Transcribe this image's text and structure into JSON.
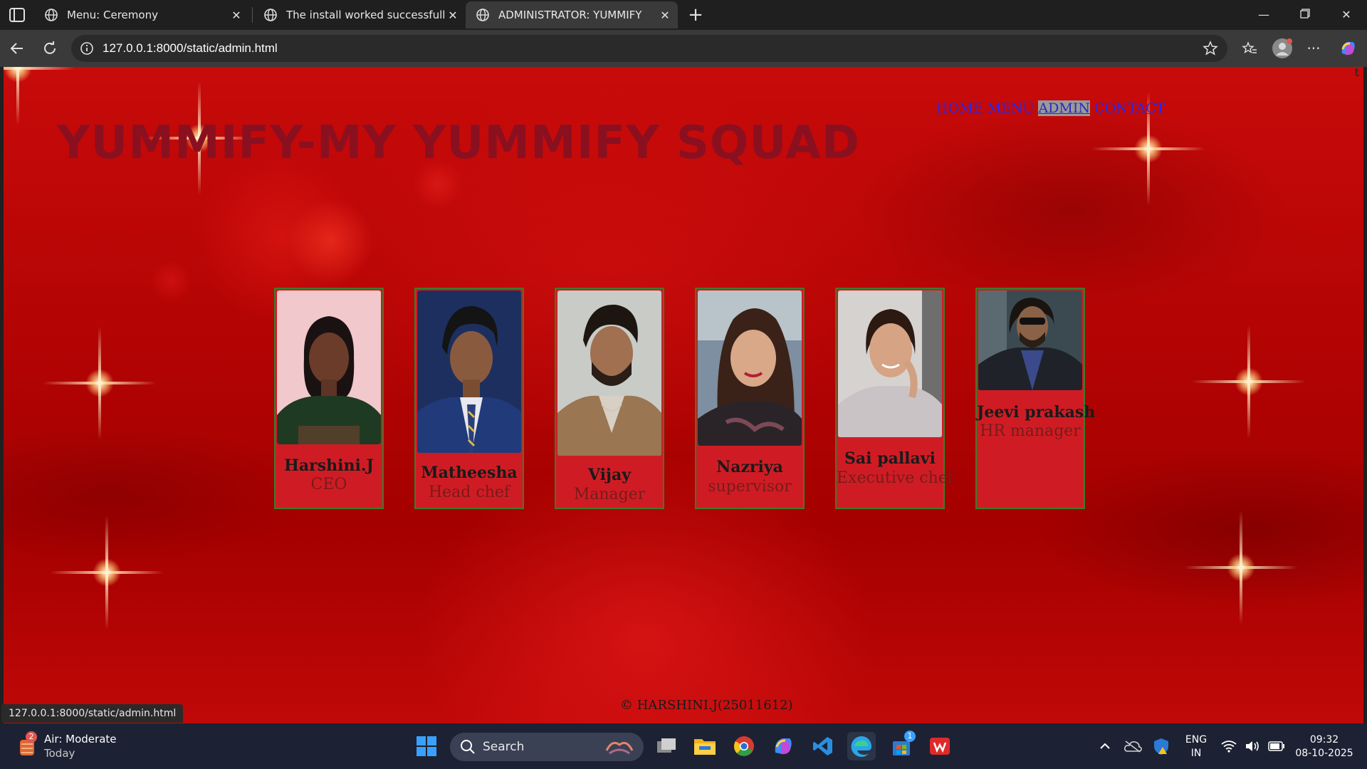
{
  "browser": {
    "tabs": [
      {
        "title": "Menu: Ceremony",
        "active": false
      },
      {
        "title": "The install worked successfully! C",
        "active": false
      },
      {
        "title": "ADMINISTRATOR: YUMMIFY",
        "active": true
      }
    ],
    "url": "127.0.0.1:8000/static/admin.html",
    "status_url": "127.0.0.1:8000/static/admin.html"
  },
  "page": {
    "title": "YUMMIFY-MY YUMMIFY SQUAD",
    "nav": [
      "HOME",
      "MENU",
      "ADMIN",
      "CONTACT"
    ],
    "corner_char": "t",
    "team": [
      {
        "name": "Harshini.J",
        "role": "CEO"
      },
      {
        "name": "Matheesha",
        "role": "Head chef"
      },
      {
        "name": "Vijay",
        "role": "Manager"
      },
      {
        "name": "Nazriya",
        "role": "supervisor"
      },
      {
        "name": "Sai pallavi",
        "role": "Executive chef"
      },
      {
        "name": "Jeevi prakash",
        "role": "HR manager"
      }
    ],
    "footer": "© HARSHINI.J(25011612)"
  },
  "taskbar": {
    "weather": {
      "badge": "2",
      "title": "Air: Moderate",
      "subtitle": "Today"
    },
    "search_label": "Search",
    "store_badge": "1",
    "lang_line1": "ENG",
    "lang_line2": "IN",
    "time": "09:32",
    "date": "08-10-2025"
  }
}
